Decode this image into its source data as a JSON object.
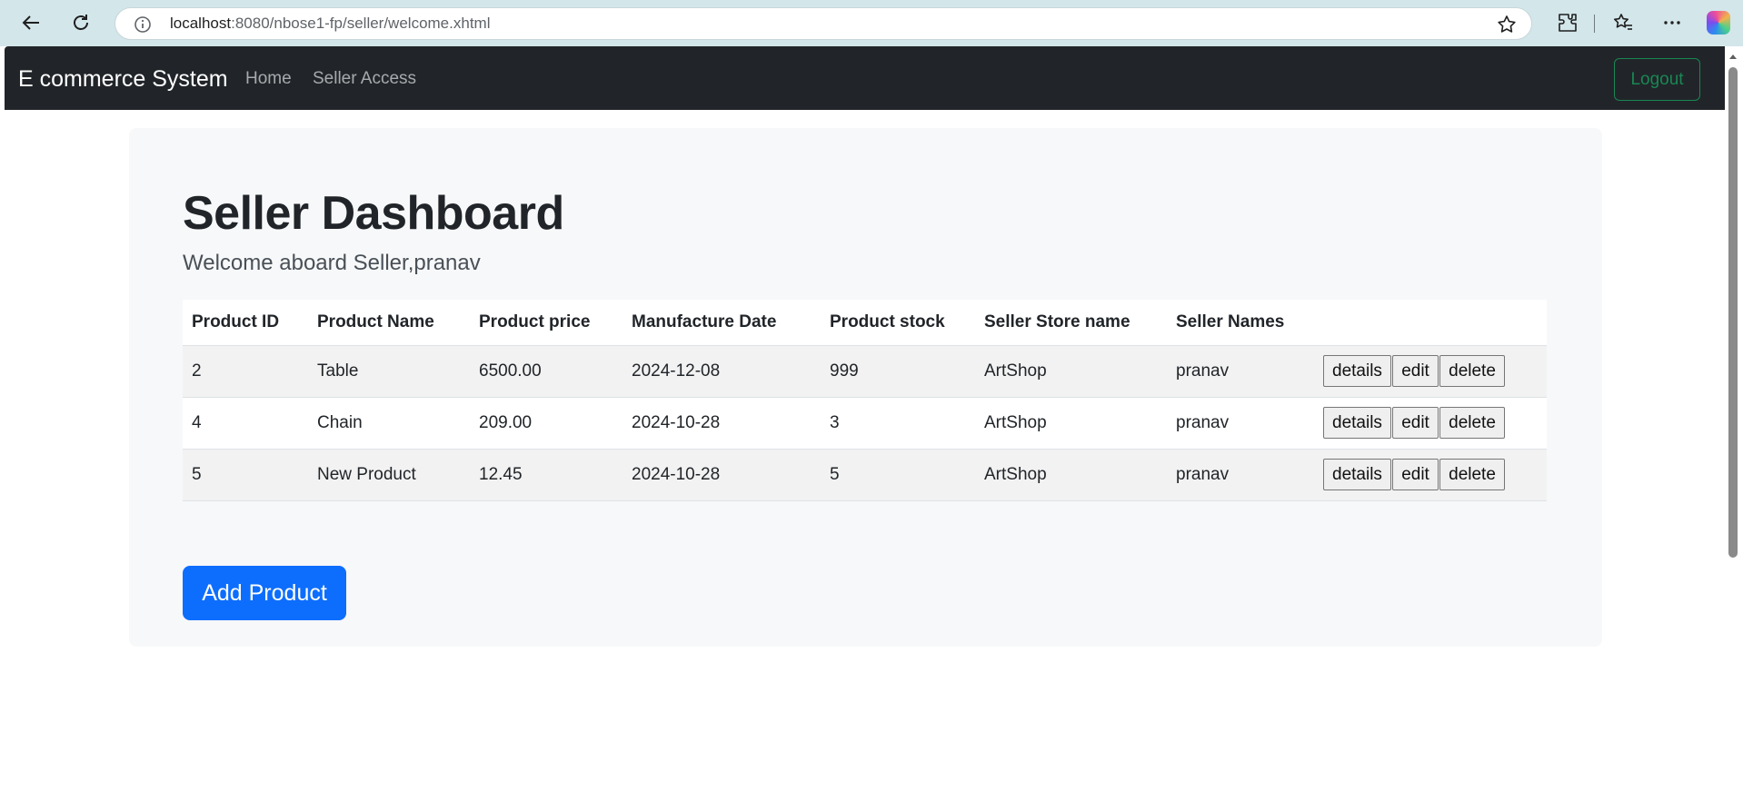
{
  "browser": {
    "url_host": "localhost",
    "url_rest": ":8080/nbose1-fp/seller/welcome.xhtml"
  },
  "navbar": {
    "brand": "E commerce System",
    "links": [
      "Home",
      "Seller Access"
    ],
    "logout_label": "Logout"
  },
  "main": {
    "title": "Seller Dashboard",
    "welcome": "Welcome aboard Seller,pranav",
    "table": {
      "headers": [
        "Product ID",
        "Product Name",
        "Product price",
        "Manufacture Date",
        "Product stock",
        "Seller Store name",
        "Seller Names"
      ],
      "rows": [
        [
          "2",
          "Table",
          "6500.00",
          "2024-12-08",
          "999",
          "ArtShop",
          "pranav"
        ],
        [
          "4",
          "Chain",
          "209.00",
          "2024-10-28",
          "3",
          "ArtShop",
          "pranav"
        ],
        [
          "5",
          "New Product",
          "12.45",
          "2024-10-28",
          "5",
          "ArtShop",
          "pranav"
        ]
      ],
      "actions": [
        "details",
        "edit",
        "delete"
      ]
    },
    "add_button": "Add Product"
  },
  "colors": {
    "navbar_bg": "#212529",
    "primary": "#0d6efd",
    "success": "#198754"
  }
}
